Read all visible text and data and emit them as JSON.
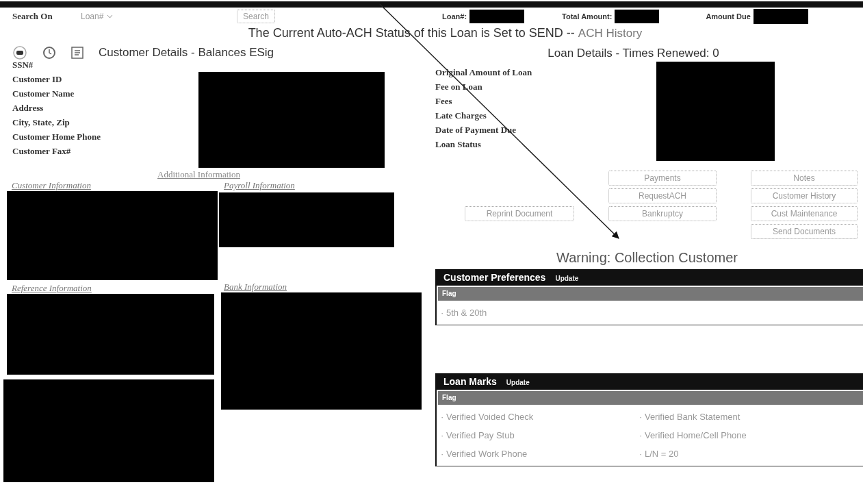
{
  "search": {
    "label": "Search On",
    "select_value": "Loan#",
    "button": "Search"
  },
  "summary": [
    {
      "label": "Loan#:"
    },
    {
      "label": "Total Amount:"
    },
    {
      "label": "Amount Due"
    }
  ],
  "status_banner": {
    "text": "The Current Auto-ACH Status of this Loan is Set to SEND --",
    "link": "ACH History"
  },
  "customer_details": {
    "title": "Customer Details - Balances ESig",
    "fields": [
      "SSN#",
      "Customer ID",
      "Customer Name",
      "Address",
      "City, State, Zip",
      "Customer Home Phone",
      "Customer Fax#"
    ]
  },
  "loan_details": {
    "title": "Loan Details - Times Renewed: 0",
    "fields": [
      "Original Amount of Loan",
      "Fee on Loan",
      "Fees",
      "Late Charges",
      "Date of Payment Due",
      "Loan Status"
    ]
  },
  "additional_information": {
    "title": "Additional Information",
    "sections": [
      "Customer Information",
      "Payroll Information",
      "Reference Information",
      "Bank Information"
    ]
  },
  "button_columns": [
    [
      "",
      "",
      "Reprint Document"
    ],
    [
      "Payments",
      "RequestACH",
      "Bankruptcy"
    ],
    [
      "Notes",
      "Customer History",
      "Cust Maintenance",
      "Send Documents"
    ]
  ],
  "warning": "Warning: Collection Customer",
  "panels": [
    {
      "title": "Customer Preferences",
      "action": "Update",
      "column": "Flag",
      "items": [
        "· 5th & 20th"
      ]
    },
    {
      "title": "Loan Marks",
      "action": "Update",
      "column": "Flag",
      "items": [
        "· Verified Voided Check",
        "· Verified Bank Statement",
        "· Verified Pay Stub",
        "· Verified Home/Cell Phone",
        "· Verified Work Phone",
        "· L/N = 20"
      ]
    }
  ]
}
